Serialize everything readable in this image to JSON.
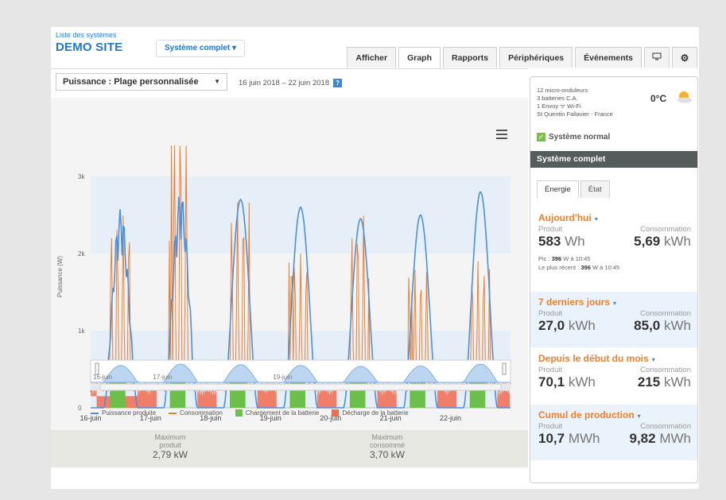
{
  "header": {
    "system_list_link": "Liste des systèmes",
    "site_name": "DEMO SITE",
    "system_dropdown": "Système complet"
  },
  "tabs": [
    {
      "label": "Afficher",
      "active": false
    },
    {
      "label": "Graph",
      "active": true
    },
    {
      "label": "Rapports",
      "active": false
    },
    {
      "label": "Périphériques",
      "active": false
    },
    {
      "label": "Événements",
      "active": false
    }
  ],
  "icons": {
    "monitor": "monitor-icon",
    "settings": "gear-icon",
    "help": "help-icon",
    "menu": "hamburger-menu-icon",
    "weather": "sun-cloud-icon",
    "check": "check-icon"
  },
  "controls": {
    "range_select": "Puissance : Plage personnalisée",
    "date_range": "16 juin 2018 – 22 juin 2018"
  },
  "colors": {
    "produced": "#4a90e2",
    "consumption": "#f07f2d",
    "battery_charge": "#6cc04a",
    "battery_discharge": "#f26a4f",
    "accent": "#1f76d0"
  },
  "chart_data": {
    "type": "line",
    "ylabel": "Puissance (W)",
    "ylim": [
      0,
      3400
    ],
    "yticks": [
      "0",
      "1k",
      "2k",
      "3k"
    ],
    "ytick_values": [
      0,
      1000,
      2000,
      3000
    ],
    "x_categories": [
      "16-juin",
      "17-juin",
      "18-juin",
      "19-juin",
      "20-juin",
      "21-juin",
      "22-juin"
    ],
    "days": 7,
    "series": [
      {
        "name": "Puissance produite",
        "kind": "line",
        "daily_peak_w": [
          2580,
          2800,
          2700,
          2600,
          2450,
          2500,
          2800
        ]
      },
      {
        "name": "Consommation",
        "kind": "line",
        "daily_peak_w": [
          2200,
          3700,
          2400,
          1700,
          2200,
          1500,
          1600
        ]
      },
      {
        "name": "Chargement de la batterie",
        "kind": "area",
        "daily_level_w": [
          520,
          550,
          520,
          520,
          540,
          480,
          560
        ]
      },
      {
        "name": "Décharge de la batterie",
        "kind": "area",
        "daily_level_w": [
          250,
          230,
          260,
          240,
          240,
          250,
          230
        ]
      }
    ],
    "navigator_labels": [
      "16-juin",
      "17-juin",
      "19-juin"
    ]
  },
  "legend": [
    {
      "label": "Puissance produite",
      "kind": "line",
      "color": "#4a90e2"
    },
    {
      "label": "Consommation",
      "kind": "line",
      "color": "#f07f2d"
    },
    {
      "label": "Chargement de la batterie",
      "kind": "square",
      "color": "#6cc04a"
    },
    {
      "label": "Décharge de la batterie",
      "kind": "square",
      "color": "#f26a4f"
    }
  ],
  "stats": {
    "max_produced_label1": "Maximum",
    "max_produced_label2": "produit",
    "max_produced_value": "2,79 kW",
    "max_consumed_label1": "Maximum",
    "max_consumed_label2": "consommé",
    "max_consumed_value": "3,70 kW"
  },
  "panel": {
    "microinverters": "12 micro-onduleurs",
    "batteries": "3 batteries C.A.",
    "envoy": "1 Envoy ᯤ Wi-Fi",
    "location": "St Quentin Fallavier - France",
    "temperature": "0°C",
    "status": "Système normal",
    "header": "Système complet",
    "subtabs": [
      "Énergie",
      "État"
    ],
    "sections": [
      {
        "title": "Aujourd'hui",
        "produced_label": "Produit",
        "produced_num": "583",
        "produced_unit": "Wh",
        "consumed_label": "Consommation",
        "consumed_num": "5,69",
        "consumed_unit": "kWh"
      },
      {
        "title": "7 derniers jours",
        "produced_label": "Produit",
        "produced_num": "27,0",
        "produced_unit": "kWh",
        "consumed_label": "Consommation",
        "consumed_num": "85,0",
        "consumed_unit": "kWh"
      },
      {
        "title": "Depuis le début du mois",
        "produced_label": "Produit",
        "produced_num": "70,1",
        "produced_unit": "kWh",
        "consumed_label": "Consommation",
        "consumed_num": "215",
        "consumed_unit": "kWh"
      },
      {
        "title": "Cumul de production",
        "produced_label": "Produit",
        "produced_num": "10,7",
        "produced_unit": "MWh",
        "consumed_label": "Consommation",
        "consumed_num": "9,82",
        "consumed_unit": "MWh"
      }
    ],
    "today_detail": {
      "peak_label": "Pic :",
      "peak_value": "396",
      "peak_suffix": "W à 10:45",
      "recent_label": "Le plus récent :",
      "recent_value": "396",
      "recent_suffix": "W à 10:45"
    }
  }
}
